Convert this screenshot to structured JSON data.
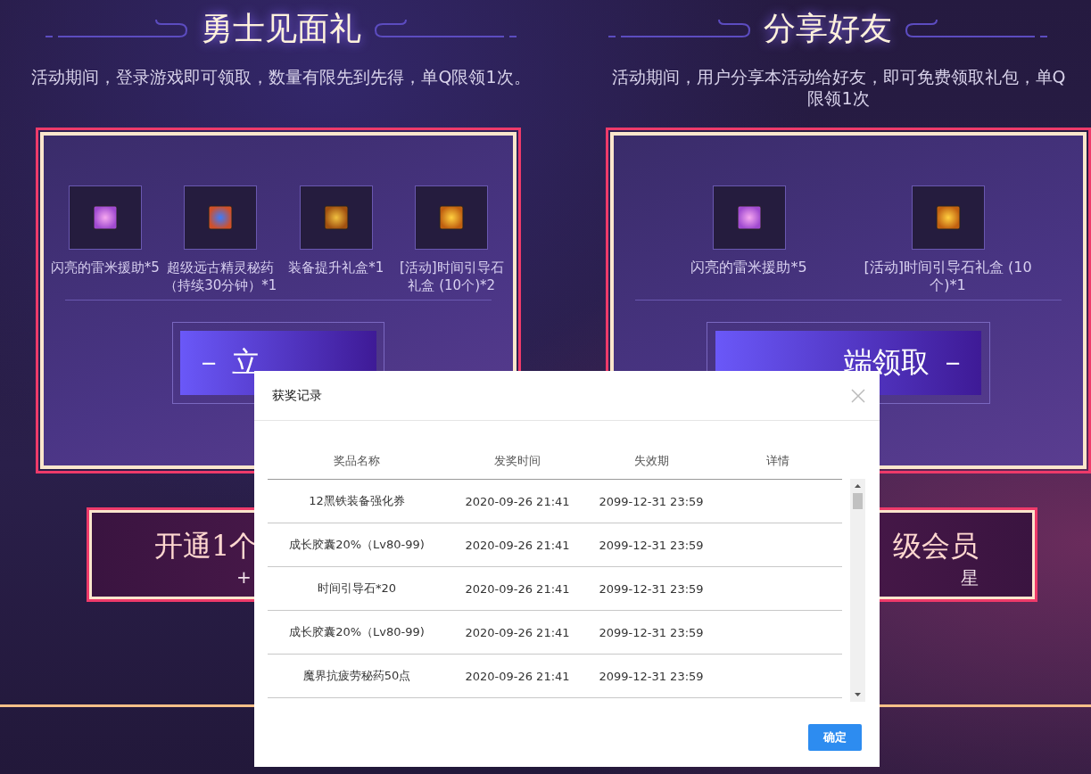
{
  "sections": [
    {
      "title": "勇士见面礼",
      "description": "活动期间，登录游戏即可领取，数量有限先到先得，单Q限领1次。",
      "items": [
        {
          "name": "闪亮的雷米援助*5"
        },
        {
          "name": "超级远古精灵秘药（持续30分钟）*1"
        },
        {
          "name": "装备提升礼盒*1"
        },
        {
          "name": "[活动]时间引导石礼盒 (10个)*2"
        }
      ],
      "button": "－ 立"
    },
    {
      "title": "分享好友",
      "description": "活动期间，用户分享本活动给好友，即可免费领取礼包，单Q限领1次",
      "items": [
        {
          "name": "闪亮的雷米援助*5"
        },
        {
          "name": "[活动]时间引导石礼盒 (10个)*1"
        }
      ],
      "button": "端领取 －"
    }
  ],
  "banner": {
    "title_left": "开通1个",
    "title_right": "级会员",
    "sub_left": "+",
    "sub_right": "星"
  },
  "dialog": {
    "title": "获奖记录",
    "columns": [
      "奖品名称",
      "发奖时间",
      "失效期",
      "详情"
    ],
    "rows": [
      [
        "12黑铁装备强化券",
        "2020-09-26 21:41",
        "2099-12-31 23:59"
      ],
      [
        "成长胶囊20%（Lv80-99)",
        "2020-09-26 21:41",
        "2099-12-31 23:59"
      ],
      [
        "时间引导石*20",
        "2020-09-26 21:41",
        "2099-12-31 23:59"
      ],
      [
        "成长胶囊20%（Lv80-99)",
        "2020-09-26 21:41",
        "2099-12-31 23:59"
      ],
      [
        "魔界抗疲劳秘药50点",
        "2020-09-26 21:41",
        "2099-12-31 23:59"
      ]
    ],
    "confirm": "确定"
  }
}
